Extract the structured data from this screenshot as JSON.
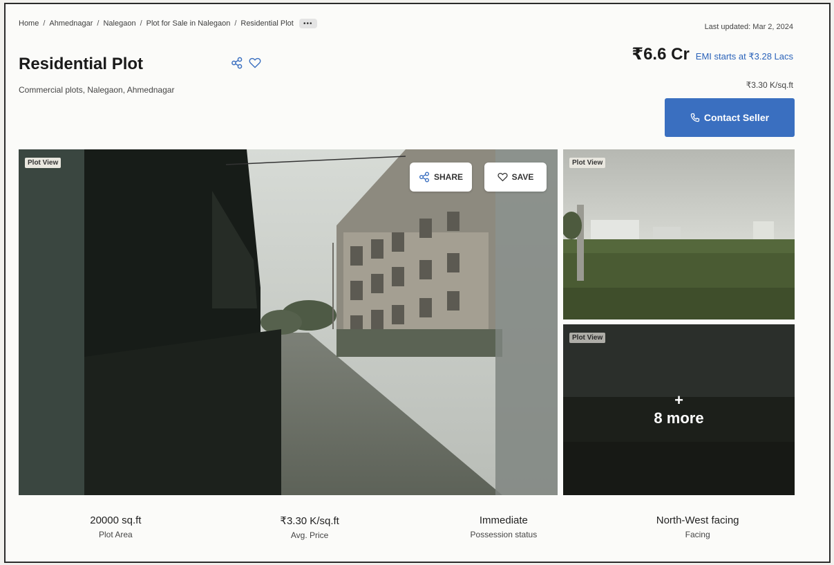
{
  "breadcrumb": {
    "items": [
      "Home",
      "Ahmednagar",
      "Nalegaon",
      "Plot for Sale in Nalegaon",
      "Residential Plot"
    ],
    "separator": "/",
    "more": "•••"
  },
  "listing": {
    "title": "Residential Plot",
    "subtitle": "Commercial plots, Nalegaon, Ahmednagar",
    "last_updated": "Last updated: Mar 2, 2024",
    "price": "₹6.6 Cr",
    "emi": "EMI starts at ₹3.28 Lacs",
    "price_per_sqft": "₹3.30 K/sq.ft",
    "contact_label": "Contact Seller"
  },
  "gallery": {
    "main_tag": "Plot View",
    "share_label": "SHARE",
    "save_label": "SAVE",
    "side_tag_1": "Plot View",
    "side_tag_2": "Plot View",
    "more_plus": "+",
    "more_label": "8 more"
  },
  "stats": [
    {
      "value": "20000 sq.ft",
      "label": "Plot Area"
    },
    {
      "value": "₹3.30 K/sq.ft",
      "label": "Avg. Price"
    },
    {
      "value": "Immediate",
      "label": "Possession status"
    },
    {
      "value": "North-West facing",
      "label": "Facing"
    }
  ],
  "icons": {
    "share": "share-icon",
    "heart": "heart-icon",
    "phone": "phone-icon"
  },
  "colors": {
    "accent": "#3a6fc0",
    "link": "#2a62b9"
  }
}
